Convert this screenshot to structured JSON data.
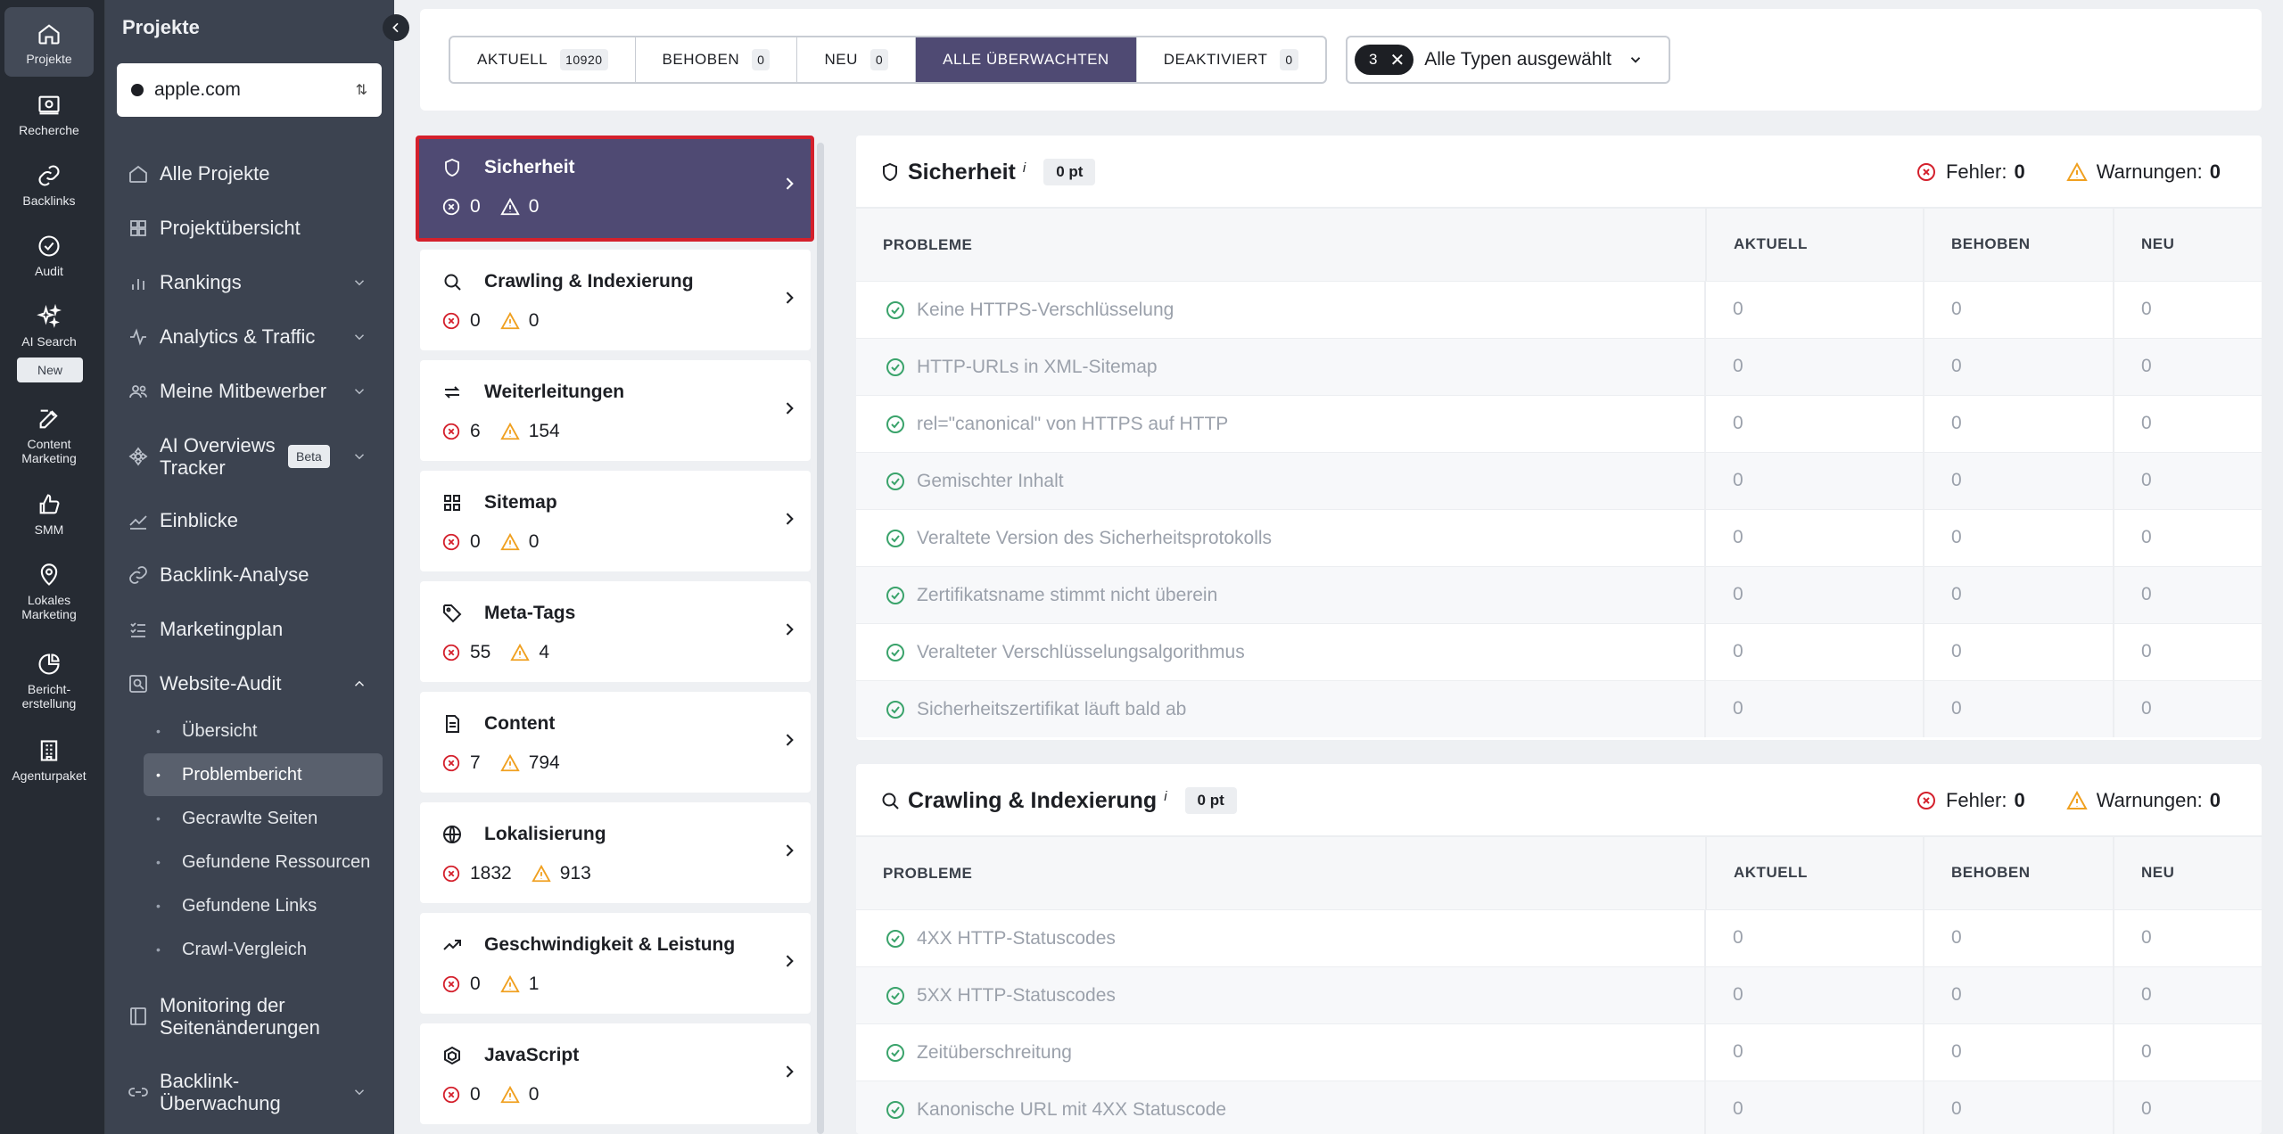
{
  "rail": {
    "items": [
      {
        "label": "Projekte",
        "icon": "home-icon"
      },
      {
        "label": "Recherche",
        "icon": "research-icon"
      },
      {
        "label": "Backlinks",
        "icon": "link-icon"
      },
      {
        "label": "Audit",
        "icon": "check-circle-icon"
      },
      {
        "label": "AI Search",
        "icon": "sparkles-icon"
      },
      {
        "label": "Content Marketing",
        "icon": "edit-icon"
      },
      {
        "label": "SMM",
        "icon": "thumbs-up-icon"
      },
      {
        "label": "Lokales Marketing",
        "icon": "map-pin-icon"
      },
      {
        "label": "Bericht-erstellung",
        "icon": "pie-chart-icon"
      },
      {
        "label": "Agenturpaket",
        "icon": "building-icon"
      }
    ],
    "new_badge": "New"
  },
  "nav": {
    "title": "Projekte",
    "project": "apple.com",
    "items": [
      {
        "label": "Alle Projekte",
        "icon": "home-icon"
      },
      {
        "label": "Projektübersicht",
        "icon": "grid-icon"
      },
      {
        "label": "Rankings",
        "icon": "bar-chart-icon"
      },
      {
        "label": "Analytics & Traffic",
        "icon": "activity-icon"
      },
      {
        "label": "Meine Mitbewerber",
        "icon": "users-icon"
      },
      {
        "label": "AI Overviews Tracker",
        "icon": "ai-icon",
        "badge": "Beta"
      },
      {
        "label": "Einblicke",
        "icon": "trend-icon"
      },
      {
        "label": "Backlink-Analyse",
        "icon": "link-icon"
      },
      {
        "label": "Marketingplan",
        "icon": "list-check-icon"
      },
      {
        "label": "Website-Audit",
        "icon": "audit-icon"
      },
      {
        "label": "Monitoring der Seitenänderungen",
        "icon": "book-icon"
      },
      {
        "label": "Backlink-Überwachung",
        "icon": "link-watch-icon"
      }
    ],
    "subitems": [
      {
        "label": "Übersicht"
      },
      {
        "label": "Problembericht"
      },
      {
        "label": "Gecrawlte Seiten"
      },
      {
        "label": "Gefundene Ressourcen"
      },
      {
        "label": "Gefundene Links"
      },
      {
        "label": "Crawl-Vergleich"
      }
    ]
  },
  "filters": {
    "tabs": [
      {
        "label": "AKTUELL",
        "count": "10920"
      },
      {
        "label": "BEHOBEN",
        "count": "0"
      },
      {
        "label": "NEU",
        "count": "0"
      },
      {
        "label": "ALLE ÜBERWACHTEN",
        "count": ""
      },
      {
        "label": "DEAKTIVIERT",
        "count": "0"
      }
    ],
    "active_tab": "ALLE ÜBERWACHTEN",
    "type_chip_count": "3",
    "type_label": "Alle Typen ausgewählt"
  },
  "categories": [
    {
      "name": "Sicherheit",
      "errors": "0",
      "warnings": "0",
      "icon": "shield-icon"
    },
    {
      "name": "Crawling & Indexierung",
      "errors": "0",
      "warnings": "0",
      "icon": "search-icon"
    },
    {
      "name": "Weiterleitungen",
      "errors": "6",
      "warnings": "154",
      "icon": "redirect-icon"
    },
    {
      "name": "Sitemap",
      "errors": "0",
      "warnings": "0",
      "icon": "sitemap-icon"
    },
    {
      "name": "Meta-Tags",
      "errors": "55",
      "warnings": "4",
      "icon": "tag-icon"
    },
    {
      "name": "Content",
      "errors": "7",
      "warnings": "794",
      "icon": "document-icon"
    },
    {
      "name": "Lokalisierung",
      "errors": "1832",
      "warnings": "913",
      "icon": "globe-icon"
    },
    {
      "name": "Geschwindigkeit & Leistung",
      "errors": "0",
      "warnings": "1",
      "icon": "trending-up-icon"
    },
    {
      "name": "JavaScript",
      "errors": "0",
      "warnings": "0",
      "icon": "js-icon"
    }
  ],
  "panels": [
    {
      "title": "Sicherheit",
      "info": "i",
      "points": "0 pt",
      "errors_label": "Fehler:",
      "errors": "0",
      "warnings_label": "Warnungen:",
      "warnings": "0",
      "columns": [
        "PROBLEME",
        "AKTUELL",
        "BEHOBEN",
        "NEU"
      ],
      "rows": [
        {
          "label": "Keine HTTPS-Verschlüsselung",
          "current": "0",
          "fixed": "0",
          "new": "0"
        },
        {
          "label": "HTTP-URLs in XML-Sitemap",
          "current": "0",
          "fixed": "0",
          "new": "0"
        },
        {
          "label": "rel=\"canonical\" von HTTPS auf HTTP",
          "current": "0",
          "fixed": "0",
          "new": "0"
        },
        {
          "label": "Gemischter Inhalt",
          "current": "0",
          "fixed": "0",
          "new": "0"
        },
        {
          "label": "Veraltete Version des Sicherheitsprotokolls",
          "current": "0",
          "fixed": "0",
          "new": "0"
        },
        {
          "label": "Zertifikatsname stimmt nicht überein",
          "current": "0",
          "fixed": "0",
          "new": "0"
        },
        {
          "label": "Veralteter Verschlüsselungsalgorithmus",
          "current": "0",
          "fixed": "0",
          "new": "0"
        },
        {
          "label": "Sicherheitszertifikat läuft bald ab",
          "current": "0",
          "fixed": "0",
          "new": "0"
        }
      ]
    },
    {
      "title": "Crawling & Indexierung",
      "info": "i",
      "points": "0 pt",
      "errors_label": "Fehler:",
      "errors": "0",
      "warnings_label": "Warnungen:",
      "warnings": "0",
      "columns": [
        "PROBLEME",
        "AKTUELL",
        "BEHOBEN",
        "NEU"
      ],
      "rows": [
        {
          "label": "4XX HTTP-Statuscodes",
          "current": "0",
          "fixed": "0",
          "new": "0"
        },
        {
          "label": "5XX HTTP-Statuscodes",
          "current": "0",
          "fixed": "0",
          "new": "0"
        },
        {
          "label": "Zeitüberschreitung",
          "current": "0",
          "fixed": "0",
          "new": "0"
        },
        {
          "label": "Kanonische URL mit 4XX Statuscode",
          "current": "0",
          "fixed": "0",
          "new": "0"
        }
      ]
    }
  ],
  "colors": {
    "rail_bg": "#262b33",
    "nav_bg": "#3c4350",
    "accent": "#4f4a73",
    "error": "#d4202c",
    "warning": "#f0a020",
    "ok": "#3aa36b"
  }
}
